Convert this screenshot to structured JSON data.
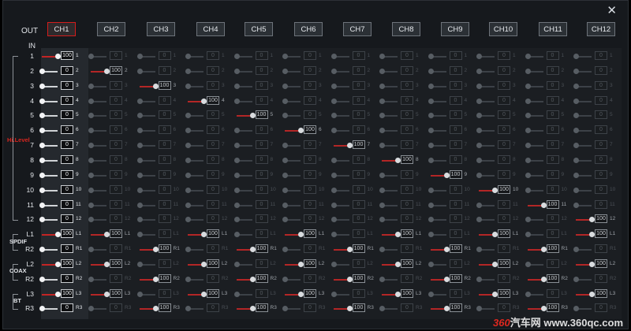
{
  "window": {
    "close_glyph": "✕"
  },
  "header": {
    "out_label": "OUT",
    "in_label": "IN",
    "active_channel": 0
  },
  "channels": [
    "CH1",
    "CH2",
    "CH3",
    "CH4",
    "CH5",
    "CH6",
    "CH7",
    "CH8",
    "CH9",
    "CH10",
    "CH11",
    "CH12"
  ],
  "rows": [
    {
      "label": "1",
      "tag": "1"
    },
    {
      "label": "2",
      "tag": "2"
    },
    {
      "label": "3",
      "tag": "3"
    },
    {
      "label": "4",
      "tag": "4"
    },
    {
      "label": "5",
      "tag": "5"
    },
    {
      "label": "6",
      "tag": "6"
    },
    {
      "label": "7",
      "tag": "7"
    },
    {
      "label": "8",
      "tag": "8"
    },
    {
      "label": "9",
      "tag": "9"
    },
    {
      "label": "10",
      "tag": "10"
    },
    {
      "label": "11",
      "tag": "11"
    },
    {
      "label": "12",
      "tag": "12"
    },
    {
      "label": "L1",
      "tag": "L1"
    },
    {
      "label": "R2",
      "tag": "R1"
    },
    {
      "label": "L2",
      "tag": "L2"
    },
    {
      "label": "R2",
      "tag": "R2"
    },
    {
      "label": "L3",
      "tag": "L3"
    },
    {
      "label": "R3",
      "tag": "R3"
    }
  ],
  "groups": [
    {
      "name": "Hi.Level",
      "color": "#d7261f"
    },
    {
      "name": "SPDIF",
      "color": "#e3e6ea"
    },
    {
      "name": "COAX",
      "color": "#e3e6ea"
    },
    {
      "name": "BT",
      "color": "#e3e6ea"
    }
  ],
  "matrix_levels": [
    [
      100,
      0,
      0,
      0,
      0,
      0,
      0,
      0,
      0,
      0,
      0,
      0
    ],
    [
      0,
      100,
      0,
      0,
      0,
      0,
      0,
      0,
      0,
      0,
      0,
      0
    ],
    [
      0,
      0,
      100,
      0,
      0,
      0,
      0,
      0,
      0,
      0,
      0,
      0
    ],
    [
      0,
      0,
      0,
      100,
      0,
      0,
      0,
      0,
      0,
      0,
      0,
      0
    ],
    [
      0,
      0,
      0,
      0,
      100,
      0,
      0,
      0,
      0,
      0,
      0,
      0
    ],
    [
      0,
      0,
      0,
      0,
      0,
      100,
      0,
      0,
      0,
      0,
      0,
      0
    ],
    [
      0,
      0,
      0,
      0,
      0,
      0,
      100,
      0,
      0,
      0,
      0,
      0
    ],
    [
      0,
      0,
      0,
      0,
      0,
      0,
      0,
      100,
      0,
      0,
      0,
      0
    ],
    [
      0,
      0,
      0,
      0,
      0,
      0,
      0,
      0,
      100,
      0,
      0,
      0
    ],
    [
      0,
      0,
      0,
      0,
      0,
      0,
      0,
      0,
      0,
      100,
      0,
      0
    ],
    [
      0,
      0,
      0,
      0,
      0,
      0,
      0,
      0,
      0,
      0,
      100,
      0
    ],
    [
      0,
      0,
      0,
      0,
      0,
      0,
      0,
      0,
      0,
      0,
      0,
      100
    ],
    [
      100,
      100,
      0,
      100,
      0,
      100,
      0,
      100,
      0,
      100,
      0,
      100
    ],
    [
      0,
      0,
      100,
      0,
      100,
      0,
      100,
      0,
      100,
      0,
      100,
      0
    ],
    [
      100,
      100,
      0,
      100,
      0,
      100,
      0,
      100,
      0,
      100,
      0,
      100
    ],
    [
      0,
      0,
      100,
      0,
      100,
      0,
      100,
      0,
      100,
      0,
      100,
      0
    ],
    [
      100,
      100,
      0,
      100,
      0,
      100,
      0,
      100,
      0,
      100,
      0,
      100
    ],
    [
      0,
      0,
      100,
      0,
      100,
      0,
      100,
      0,
      100,
      0,
      100,
      0
    ]
  ],
  "colors": {
    "active_border": "#d51c1c",
    "fill": "#c22424"
  },
  "watermark": {
    "num": "360",
    "text": "汽车网  www.360qc.com"
  }
}
